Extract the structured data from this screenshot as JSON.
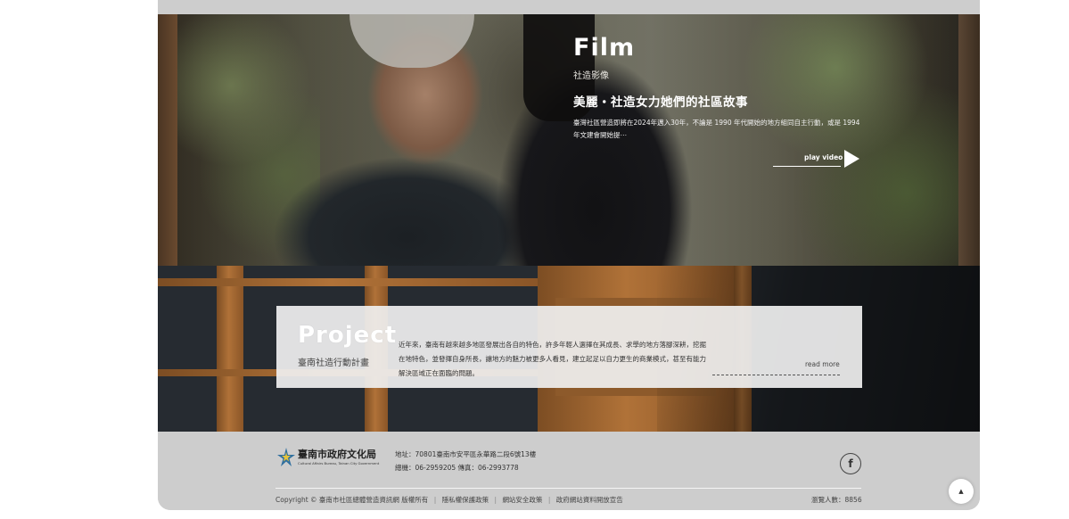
{
  "film": {
    "heading": "Film",
    "subheading": "社造影像",
    "title": "美麗・社造女力她們的社區故事",
    "description": "臺灣社區營造即將在2024年邁入30年，不論是 1990 年代開始的地方組同自主行動，或是 1994 年文建會開始提⋯",
    "play_label": "play video",
    "play_icon": "play-icon"
  },
  "project": {
    "heading": "Project",
    "subheading": "臺南社造行動計畫",
    "description": "近年來，臺南有越來越多地區發展出各自的特色，許多年輕人選擇在其成長、求學的地方落腳深耕，挖掘在地特色，並發揮自身所長，讓地方的魅力被更多人看見，建立起足以自力更生的商業模式，甚至有能力解決區域正在面臨的問題。",
    "read_more": "read more"
  },
  "footer": {
    "logo_name": "臺南市政府文化局",
    "logo_en": "Cultural Affairs Bureau, Tainan City Government",
    "address": "地址：70801臺南市安平區永華路二段6號13樓",
    "phone": "總機：06-2959205 傳真：06-2993778",
    "facebook_label": "f",
    "copyright": "Copyright © 臺南市社區總體營造資訊網 版權所有",
    "links": [
      "隱私權保護政策",
      "網站安全政策",
      "政府網站資料開放宣告"
    ],
    "separator": "|",
    "visitors": "瀏覽人數：8856"
  },
  "to_top": {
    "label": "▲",
    "icon": "arrow-up-icon"
  }
}
